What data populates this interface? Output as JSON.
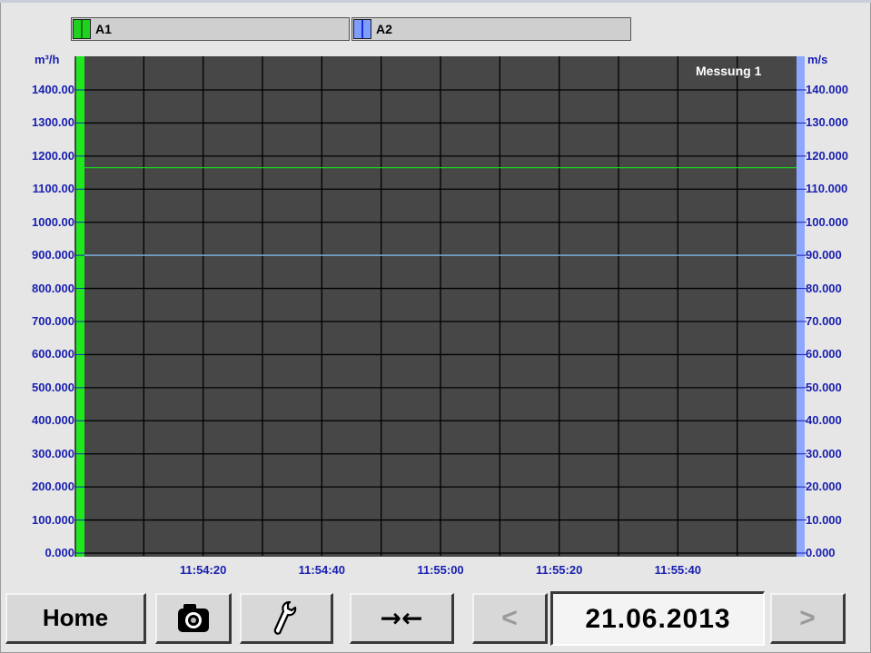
{
  "legend": [
    {
      "label": "A1",
      "color": "#1fd21f"
    },
    {
      "label": "A2",
      "color": "#7f9cff"
    }
  ],
  "axes": {
    "left_unit": "m³/h",
    "right_unit": "m/s",
    "left_ticks": [
      "1400.00",
      "1300.00",
      "1200.00",
      "1100.00",
      "1000.00",
      "900.000",
      "800.000",
      "700.000",
      "600.000",
      "500.000",
      "400.000",
      "300.000",
      "200.000",
      "100.000",
      "0.000"
    ],
    "right_ticks": [
      "140.000",
      "130.000",
      "120.000",
      "110.000",
      "100.000",
      "90.000",
      "80.000",
      "70.000",
      "60.000",
      "50.000",
      "40.000",
      "30.000",
      "20.000",
      "10.000",
      "0.000"
    ],
    "x_ticks": [
      "11:54:20",
      "11:54:40",
      "11:55:00",
      "11:55:20",
      "11:55:40"
    ]
  },
  "measurement_label": "Messung 1",
  "chart_data": {
    "type": "line",
    "y_left": {
      "unit": "m³/h",
      "range": [
        0,
        1500
      ]
    },
    "y_right": {
      "unit": "m/s",
      "range": [
        0,
        150
      ]
    },
    "x_ticks": [
      "11:54:20",
      "11:54:40",
      "11:55:00",
      "11:55:20",
      "11:55:40"
    ],
    "series": [
      {
        "name": "A1",
        "color": "#1fd21f",
        "axis": "left",
        "values": [
          1165,
          1165
        ]
      },
      {
        "name": "A2",
        "color": "#8fc8ff",
        "axis": "right",
        "values": [
          90,
          90
        ]
      }
    ]
  },
  "toolbar": {
    "home_label": "Home",
    "camera_icon": "camera-icon",
    "settings_icon": "wrench-icon",
    "zoom_icon": "arrows-in-icon",
    "zoom_label": "→←",
    "prev_label": "<",
    "next_label": ">",
    "date": "21.06.2013"
  },
  "colors": {
    "plot_bg": "#474747",
    "axis_text": "#1a20b0",
    "grid": "#000000"
  }
}
